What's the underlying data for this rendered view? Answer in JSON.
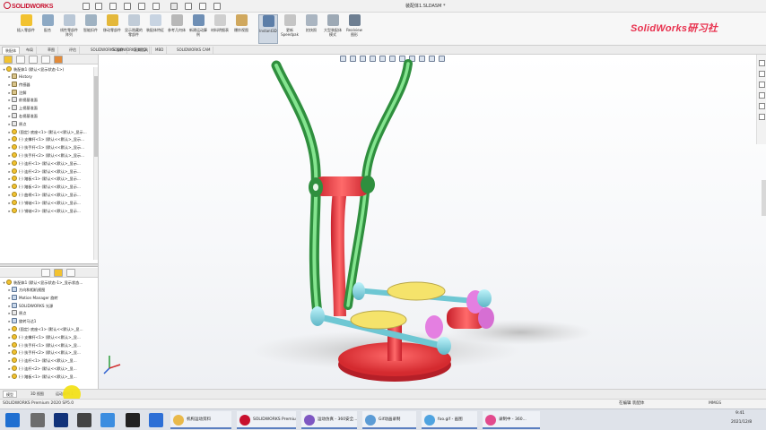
{
  "app": {
    "brand": "SOLIDWORKS",
    "document_title": "装配体1.SLDASM *",
    "watermark": "SolidWorks研习社"
  },
  "ribbon": {
    "buttons": [
      {
        "label": "插入零部件",
        "color": "#f2c230"
      },
      {
        "label": "配合",
        "color": "#8da9c4"
      },
      {
        "label": "线性零部件阵列",
        "color": "#b9c7d6"
      },
      {
        "label": "智能扣件",
        "color": "#9fb2c2"
      },
      {
        "label": "移动零部件",
        "color": "#e4b83a"
      },
      {
        "label": "显示隐藏的零部件",
        "color": "#c1ccd8"
      },
      {
        "label": "装配体特征",
        "color": "#c8d4e2"
      },
      {
        "label": "参考几何体",
        "color": "#b8b8b8"
      },
      {
        "label": "新建运动算例",
        "color": "#6f8fb5"
      },
      {
        "label": "材料明细表",
        "color": "#cfcfcf"
      },
      {
        "label": "爆炸视图",
        "color": "#d0a85e"
      },
      {
        "label": "Instant3D",
        "color": "#5c7ea8"
      },
      {
        "label": "更新 Speedpak",
        "color": "#c5c5c5"
      },
      {
        "label": "拍快照",
        "color": "#aab5c1"
      },
      {
        "label": "大型装配体模式",
        "color": "#9da9b5"
      },
      {
        "label": "Realview 图形",
        "color": "#6e7f92"
      }
    ],
    "active_index": 11
  },
  "command_tabs": [
    "装配体",
    "布局",
    "草图",
    "评估",
    "SOLIDWORKS 插件",
    "SOLIDWORKS MBD",
    "渲染工具",
    "MBD",
    "SOLIDWORKS CAM"
  ],
  "command_tab_selected": 0,
  "feature_tree": {
    "root": "装配体1 (默认<显示状态-1>)",
    "items": [
      {
        "label": "History",
        "icon": "folder",
        "indent": 1
      },
      {
        "label": "传感器",
        "icon": "folder",
        "indent": 1
      },
      {
        "label": "注解",
        "icon": "folder",
        "indent": 1
      },
      {
        "label": "前视基准面",
        "icon": "plane",
        "indent": 1
      },
      {
        "label": "上视基准面",
        "icon": "plane",
        "indent": 1
      },
      {
        "label": "右视基准面",
        "icon": "plane",
        "indent": 1
      },
      {
        "label": "原点",
        "icon": "plane",
        "indent": 1
      },
      {
        "label": "(固定) 底座<1> (默认<<默认>_显示...",
        "icon": "part",
        "indent": 1
      },
      {
        "label": "(-) 支撑杆<1> (默认<<默认>_显示...",
        "icon": "part",
        "indent": 1
      },
      {
        "label": "(-) 扶手杆<1> (默认<<默认>_显示...",
        "icon": "part",
        "indent": 1
      },
      {
        "label": "(-) 扶手杆<2> (默认<<默认>_显示...",
        "icon": "part",
        "indent": 1
      },
      {
        "label": "(-) 连杆<1> (默认<<默认>_显示...",
        "icon": "part",
        "indent": 1
      },
      {
        "label": "(-) 连杆<2> (默认<<默认>_显示...",
        "icon": "part",
        "indent": 1
      },
      {
        "label": "(-) 踏板<1> (默认<<默认>_显示...",
        "icon": "part",
        "indent": 1
      },
      {
        "label": "(-) 踏板<2> (默认<<默认>_显示...",
        "icon": "part",
        "indent": 1
      },
      {
        "label": "(-) 曲柄<1> (默认<<默认>_显示...",
        "icon": "part",
        "indent": 1
      },
      {
        "label": "(-) 销轴<1> (默认<<默认>_显示...",
        "icon": "part",
        "indent": 1
      },
      {
        "label": "(-) 销轴<2> (默认<<默认>_显示...",
        "icon": "part",
        "indent": 1
      }
    ]
  },
  "motion_tree": {
    "root": "装配体1 (默认<显示状态-1>_显示状态...",
    "items": [
      {
        "label": "方向和相机视图",
        "icon": "gear",
        "indent": 1
      },
      {
        "label": "Motion Manager 旋转",
        "icon": "gear",
        "indent": 1
      },
      {
        "label": "SOLIDWORKS 光源",
        "icon": "gear",
        "indent": 1
      },
      {
        "label": "原点",
        "icon": "plane",
        "indent": 1
      },
      {
        "label": "旋转马达1",
        "icon": "gear",
        "indent": 1
      },
      {
        "label": "(固定) 底座<1> (默认<<默认>_显...",
        "icon": "part",
        "indent": 1
      },
      {
        "label": "(-) 支撑杆<1> (默认<<默认>_显...",
        "icon": "part",
        "indent": 1
      },
      {
        "label": "(-) 扶手杆<1> (默认<<默认>_显...",
        "icon": "part",
        "indent": 1
      },
      {
        "label": "(-) 扶手杆<2> (默认<<默认>_显...",
        "icon": "part",
        "indent": 1
      },
      {
        "label": "(-) 连杆<1> (默认<<默认>_显...",
        "icon": "part",
        "indent": 1
      },
      {
        "label": "(-) 连杆<2> (默认<<默认>_显...",
        "icon": "part",
        "indent": 1
      },
      {
        "label": "(-) 踏板<1> (默认<<默认>_显...",
        "icon": "part",
        "indent": 1
      }
    ]
  },
  "motion_tabs": [
    "模型",
    "3D 视图",
    "运动算例 1"
  ],
  "status": {
    "left": "SOLIDWORKS Premium 2020 SP5.0",
    "middle": "在编辑 装配体",
    "units": "MMGS",
    "time": "9:41",
    "date": "2021/12/8"
  },
  "taskbar": {
    "windows": [
      {
        "label": "机构运动资料",
        "color": "#e9b94a"
      },
      {
        "label": "SOLIDWORKS Premium...",
        "color": "#c8102e"
      },
      {
        "label": "运动仿真 - 360安全...",
        "color": "#7e57c2"
      },
      {
        "label": "Gif动画录制",
        "color": "#5b9bd5"
      },
      {
        "label": "foo.gif - 画图",
        "color": "#4fa3e0"
      },
      {
        "label": "录制中 - 360...",
        "color": "#e24a8d"
      }
    ]
  },
  "icons": {
    "search": "search-icon",
    "rebuild": "rebuild-icon",
    "save": "save-icon",
    "print": "print-icon",
    "undo": "undo-icon",
    "options": "gear-icon"
  }
}
